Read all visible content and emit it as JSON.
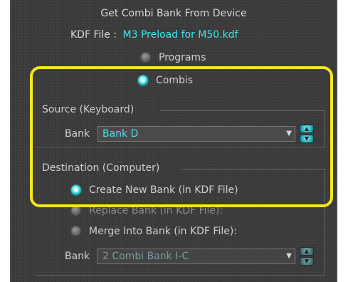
{
  "dialog": {
    "title": "Get Combi Bank From Device",
    "kdf_label": "KDF File :",
    "kdf_value": "M3 Preload for M50.kdf"
  },
  "type_options": [
    {
      "label": "Programs",
      "selected": false
    },
    {
      "label": "Combis",
      "selected": true
    }
  ],
  "source": {
    "group_label": "Source (Keyboard)",
    "bank_label": "Bank",
    "bank_value": "Bank D"
  },
  "destination": {
    "group_label": "Destination (Computer)",
    "options": [
      {
        "label": "Create New Bank (in KDF File)",
        "selected": true
      },
      {
        "label": "Replace Bank (in KDF File):",
        "selected": false
      },
      {
        "label": "Merge Into Bank (in KDF File):",
        "selected": false
      }
    ],
    "bank_label": "Bank",
    "bank_value": "2 Combi Bank I-C"
  },
  "colors": {
    "accent": "#3fe6f0",
    "highlight": "#f5e81a",
    "panel_bg": "#3a3a3a"
  }
}
